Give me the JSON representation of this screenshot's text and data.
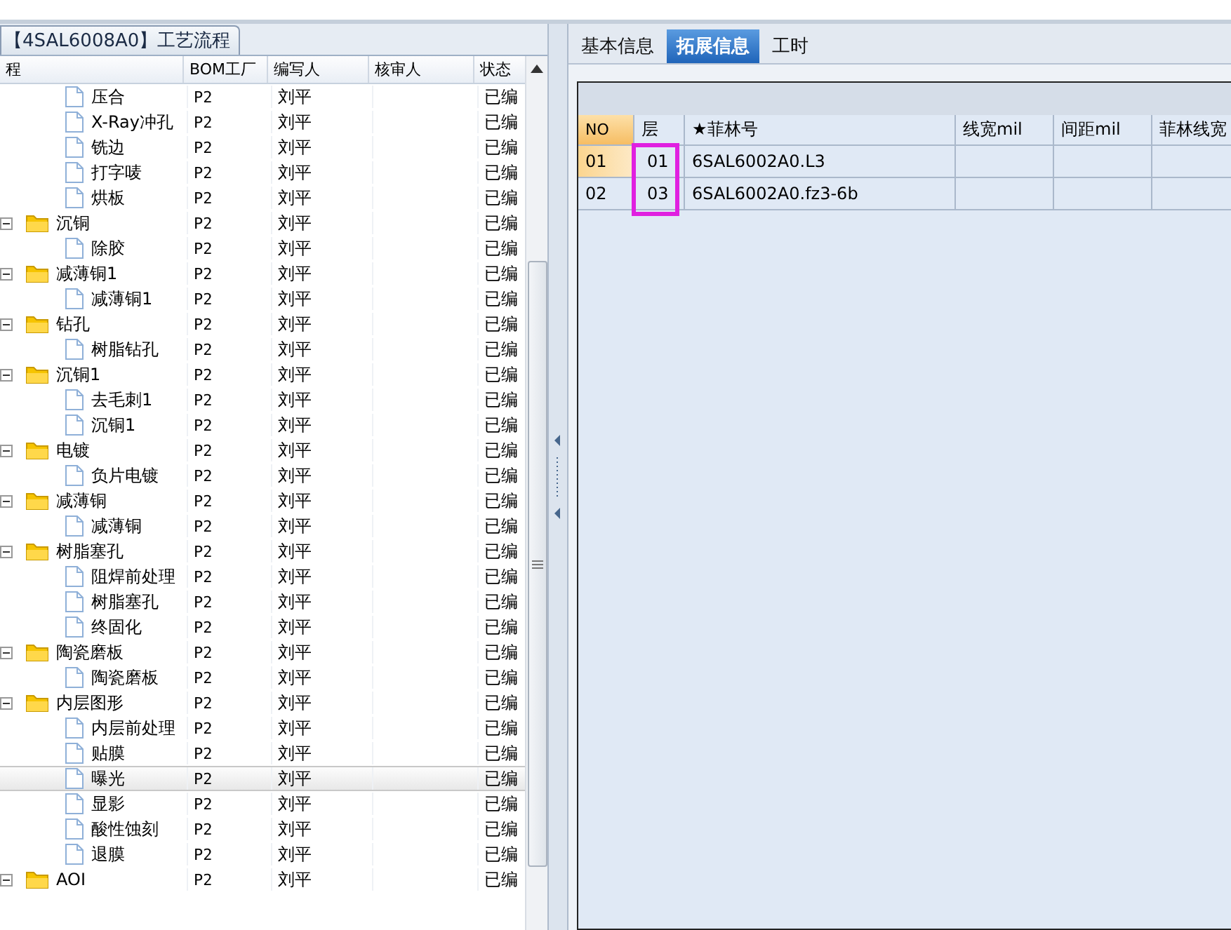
{
  "left_panel": {
    "tab": "【4SAL6008A0】工艺流程",
    "columns": [
      "程",
      "BOM工厂",
      "编写人",
      "核审人",
      "状态"
    ],
    "tree": [
      {
        "children": [
          {
            "label": "压合",
            "factory": "P2",
            "writer": "刘平",
            "status": "已编",
            "selected": false
          },
          {
            "label": "X-Ray冲孔",
            "factory": "P2",
            "writer": "刘平",
            "status": "已编",
            "selected": false
          },
          {
            "label": "铣边",
            "factory": "P2",
            "writer": "刘平",
            "status": "已编",
            "selected": false
          },
          {
            "label": "打字唛",
            "factory": "P2",
            "writer": "刘平",
            "status": "已编",
            "selected": false
          },
          {
            "label": "烘板",
            "factory": "P2",
            "writer": "刘平",
            "status": "已编",
            "selected": false
          }
        ]
      },
      {
        "label": "沉铜",
        "factory": "P2",
        "writer": "刘平",
        "status": "已编",
        "selected": false,
        "expanded": true,
        "children": [
          {
            "label": "除胶",
            "factory": "P2",
            "writer": "刘平",
            "status": "已编",
            "selected": false
          }
        ]
      },
      {
        "label": "减薄铜1",
        "factory": "P2",
        "writer": "刘平",
        "status": "已编",
        "selected": false,
        "expanded": true,
        "children": [
          {
            "label": "减薄铜1",
            "factory": "P2",
            "writer": "刘平",
            "status": "已编",
            "selected": false
          }
        ]
      },
      {
        "label": "钻孔",
        "factory": "P2",
        "writer": "刘平",
        "status": "已编",
        "selected": false,
        "expanded": true,
        "children": [
          {
            "label": "树脂钻孔",
            "factory": "P2",
            "writer": "刘平",
            "status": "已编",
            "selected": false
          }
        ]
      },
      {
        "label": "沉铜1",
        "factory": "P2",
        "writer": "刘平",
        "status": "已编",
        "selected": false,
        "expanded": true,
        "children": [
          {
            "label": "去毛刺1",
            "factory": "P2",
            "writer": "刘平",
            "status": "已编",
            "selected": false
          },
          {
            "label": "沉铜1",
            "factory": "P2",
            "writer": "刘平",
            "status": "已编",
            "selected": false
          }
        ]
      },
      {
        "label": "电镀",
        "factory": "P2",
        "writer": "刘平",
        "status": "已编",
        "selected": false,
        "expanded": true,
        "children": [
          {
            "label": "负片电镀",
            "factory": "P2",
            "writer": "刘平",
            "status": "已编",
            "selected": false
          }
        ]
      },
      {
        "label": "减薄铜",
        "factory": "P2",
        "writer": "刘平",
        "status": "已编",
        "selected": false,
        "expanded": true,
        "children": [
          {
            "label": "减薄铜",
            "factory": "P2",
            "writer": "刘平",
            "status": "已编",
            "selected": false
          }
        ]
      },
      {
        "label": "树脂塞孔",
        "factory": "P2",
        "writer": "刘平",
        "status": "已编",
        "selected": false,
        "expanded": true,
        "children": [
          {
            "label": "阻焊前处理",
            "factory": "P2",
            "writer": "刘平",
            "status": "已编",
            "selected": false
          },
          {
            "label": "树脂塞孔",
            "factory": "P2",
            "writer": "刘平",
            "status": "已编",
            "selected": false
          },
          {
            "label": "终固化",
            "factory": "P2",
            "writer": "刘平",
            "status": "已编",
            "selected": false
          }
        ]
      },
      {
        "label": "陶瓷磨板",
        "factory": "P2",
        "writer": "刘平",
        "status": "已编",
        "selected": false,
        "expanded": true,
        "children": [
          {
            "label": "陶瓷磨板",
            "factory": "P2",
            "writer": "刘平",
            "status": "已编",
            "selected": false
          }
        ]
      },
      {
        "label": "内层图形",
        "factory": "P2",
        "writer": "刘平",
        "status": "已编",
        "selected": false,
        "expanded": true,
        "children": [
          {
            "label": "内层前处理",
            "factory": "P2",
            "writer": "刘平",
            "status": "已编",
            "selected": false
          },
          {
            "label": "贴膜",
            "factory": "P2",
            "writer": "刘平",
            "status": "已编",
            "selected": false
          },
          {
            "label": "曝光",
            "factory": "P2",
            "writer": "刘平",
            "status": "已编",
            "selected": true
          },
          {
            "label": "显影",
            "factory": "P2",
            "writer": "刘平",
            "status": "已编",
            "selected": false
          },
          {
            "label": "酸性蚀刻",
            "factory": "P2",
            "writer": "刘平",
            "status": "已编",
            "selected": false
          },
          {
            "label": "退膜",
            "factory": "P2",
            "writer": "刘平",
            "status": "已编",
            "selected": false
          }
        ]
      },
      {
        "label": "AOI",
        "factory": "P2",
        "writer": "刘平",
        "status": "已编",
        "selected": false,
        "expanded": true
      }
    ]
  },
  "right_panel": {
    "tabs": [
      {
        "label": "基本信息",
        "selected": false
      },
      {
        "label": "拓展信息",
        "selected": true
      },
      {
        "label": "工时",
        "selected": false
      }
    ],
    "grid": {
      "columns": [
        "NO",
        "层",
        "★菲林号",
        "线宽mil",
        "间距mil",
        "菲林线宽"
      ],
      "rows": [
        {
          "cells": [
            "01",
            "01",
            "6SAL6002A0.L3"
          ],
          "selected": true
        },
        {
          "cells": [
            "02",
            "03",
            "6SAL6002A0.fz3-6b"
          ],
          "selected": false
        }
      ]
    }
  }
}
